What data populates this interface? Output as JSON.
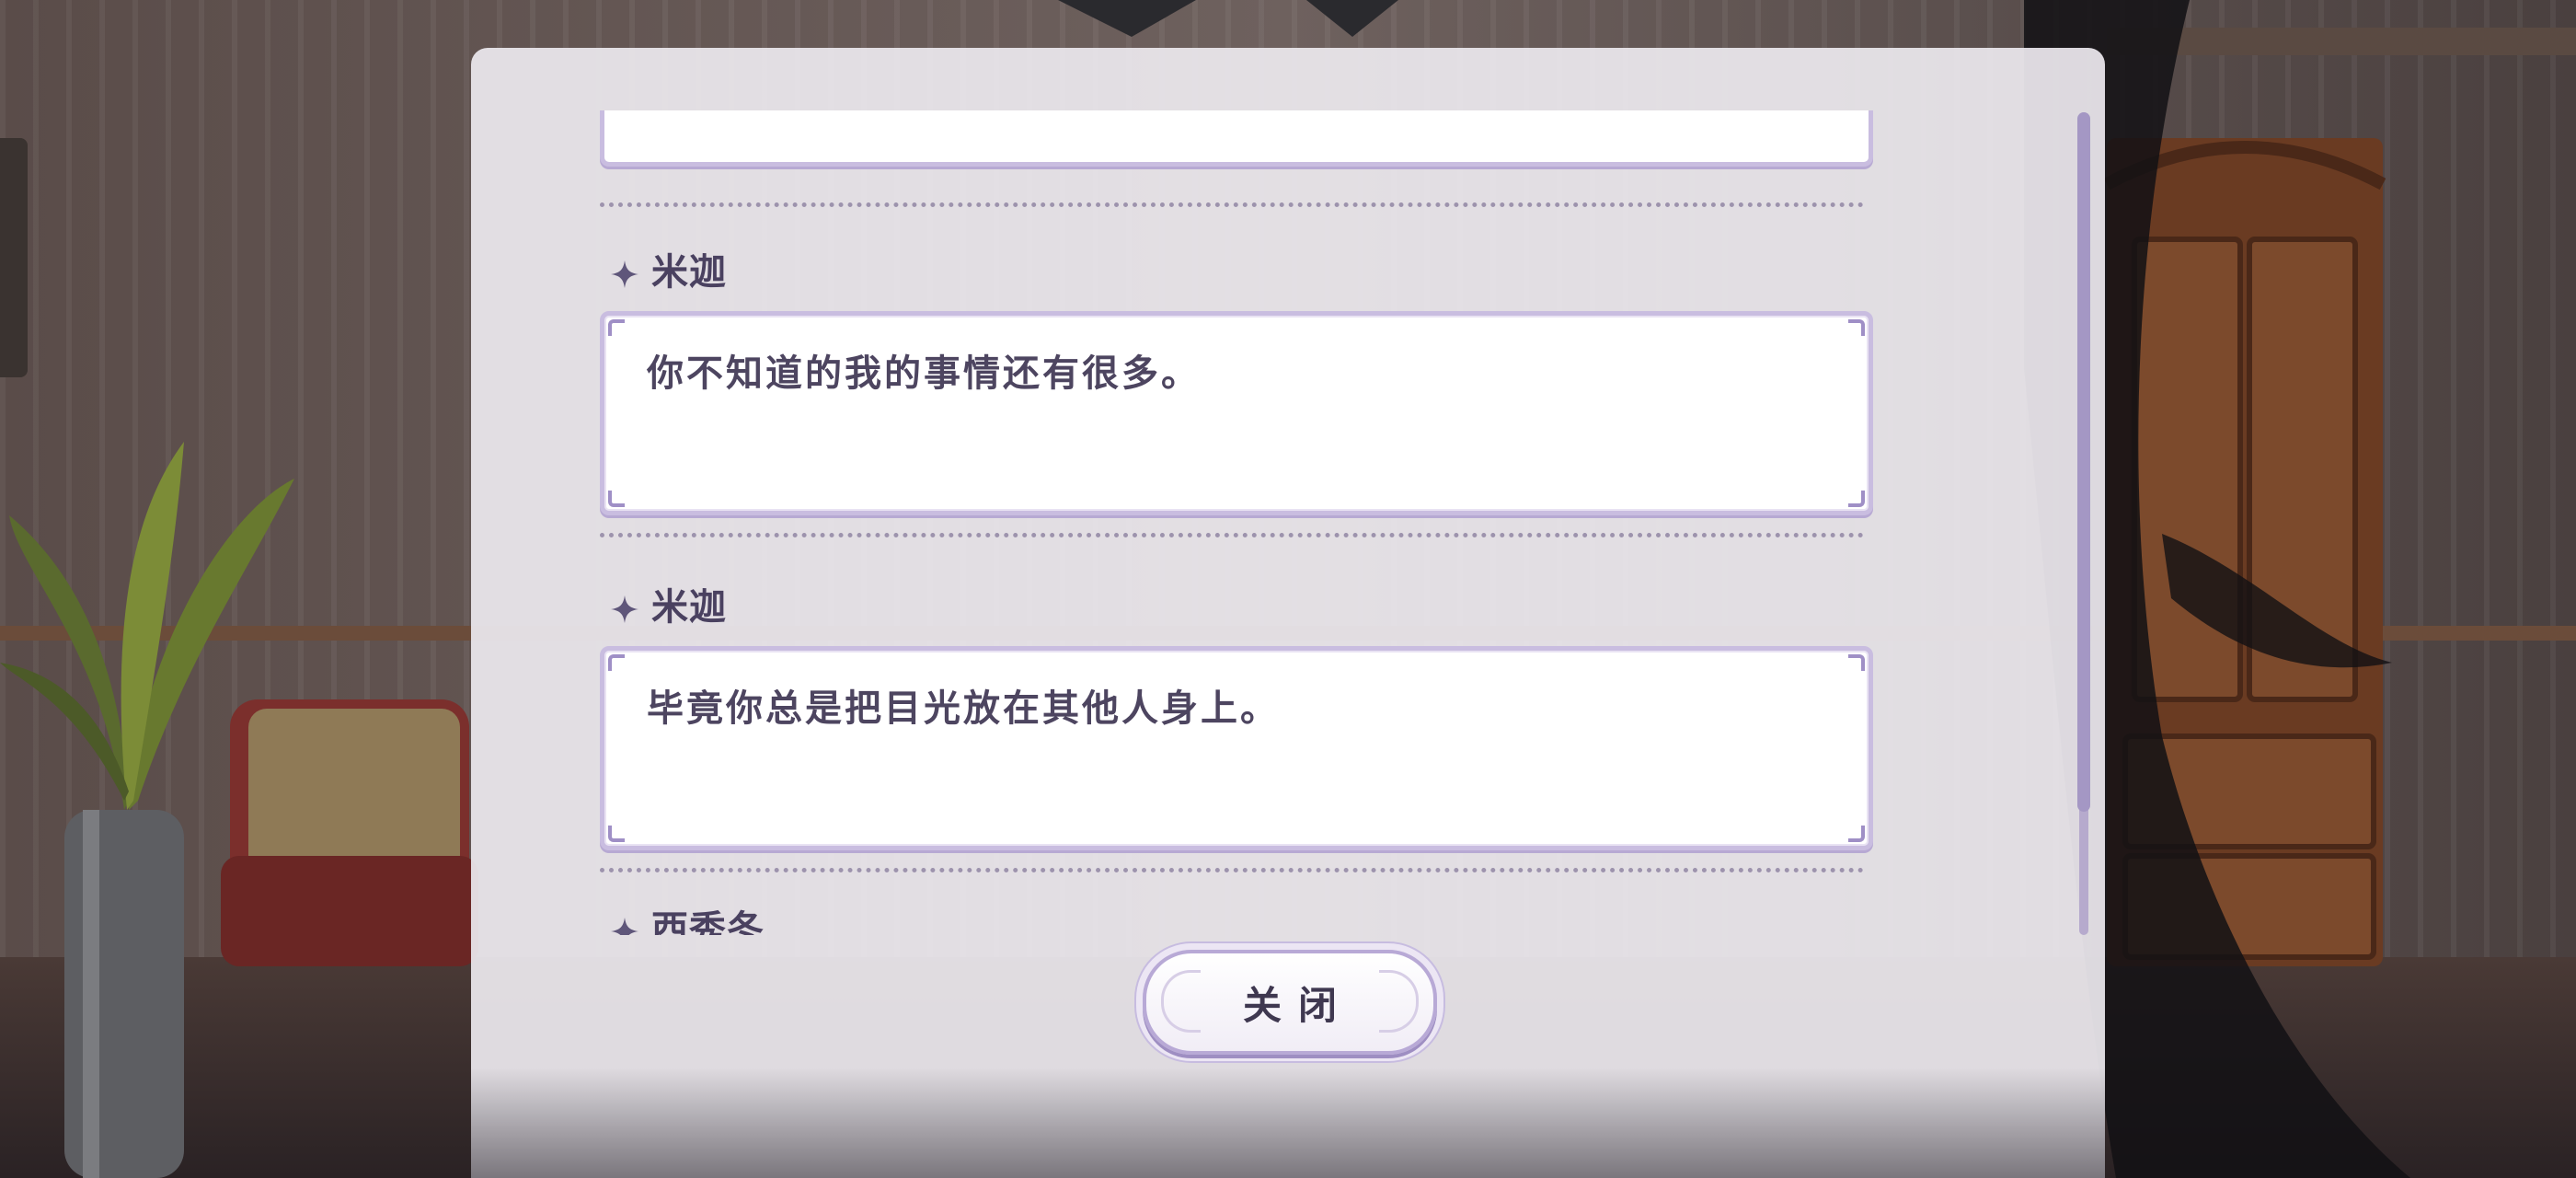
{
  "dialog_log": {
    "entries": [
      {
        "speaker": "米迦",
        "text": "你不知道的我的事情还有很多。"
      },
      {
        "speaker": "米迦",
        "text": "毕竟你总是把目光放在其他人身上。"
      },
      {
        "speaker": "西秀冬",
        "text": ""
      }
    ]
  },
  "close_button": {
    "label": "关闭"
  },
  "colors": {
    "panel": "#ece8ee",
    "bubble_border": "#c9bde0",
    "text": "#4d4560",
    "accent": "#a497c4"
  },
  "icons": {
    "speaker_marker": "four-point-star-icon"
  }
}
